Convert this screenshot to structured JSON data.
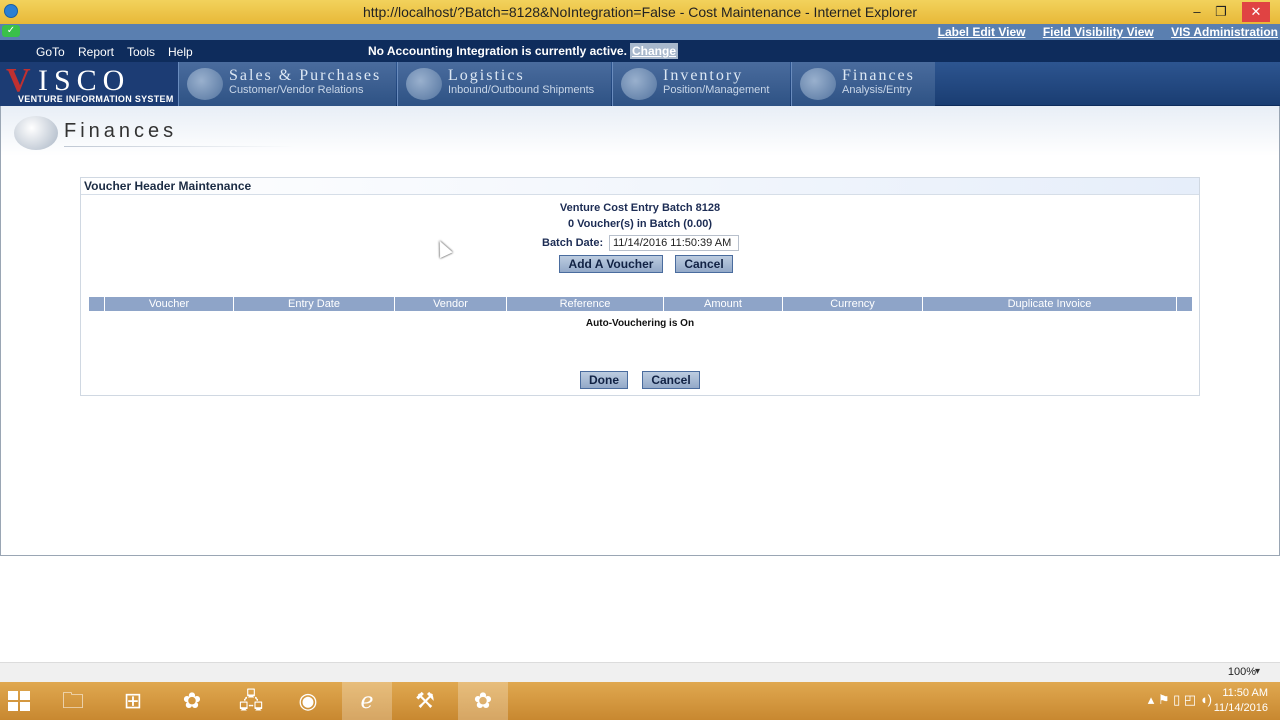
{
  "window": {
    "title": "http://localhost/?Batch=8128&NoIntegration=False - Cost Maintenance - Internet Explorer",
    "minimize": "–",
    "restore": "❐",
    "close": "✕"
  },
  "top_links": [
    "Label Edit View",
    "Field Visibility View",
    "VIS Administration"
  ],
  "menu": {
    "items": [
      "GoTo",
      "Report",
      "Tools",
      "Help"
    ],
    "integration_text": "No Accounting Integration is currently active.",
    "change_label": "Change"
  },
  "logo": {
    "v": "V",
    "isco": "ISCO",
    "subtitle": "VENTURE INFORMATION SYSTEM"
  },
  "nav_tabs": [
    {
      "title": "Sales & Purchases",
      "subtitle": "Customer/Vendor Relations"
    },
    {
      "title": "Logistics",
      "subtitle": "Inbound/Outbound Shipments"
    },
    {
      "title": "Inventory",
      "subtitle": "Position/Management"
    },
    {
      "title": "Finances",
      "subtitle": "Analysis/Entry"
    }
  ],
  "page": {
    "title": "Finances"
  },
  "panel": {
    "header": "Voucher Header Maintenance",
    "batch_title": "Venture Cost Entry Batch 8128",
    "voucher_count": "0 Voucher(s) in Batch (0.00)",
    "batch_date_label": "Batch Date:",
    "batch_date_value": "11/14/2016 11:50:39 AM",
    "add_voucher_label": "Add A Voucher",
    "cancel_label": "Cancel",
    "columns": [
      "Voucher",
      "Entry Date",
      "Vendor",
      "Reference",
      "Amount",
      "Currency",
      "Duplicate Invoice"
    ],
    "auto_vouchering": "Auto-Vouchering is On",
    "done_label": "Done",
    "cancel2_label": "Cancel"
  },
  "statusbar": {
    "zoom": "100%"
  },
  "taskbar": {
    "time": "11:50 AM",
    "date": "11/14/2016"
  }
}
